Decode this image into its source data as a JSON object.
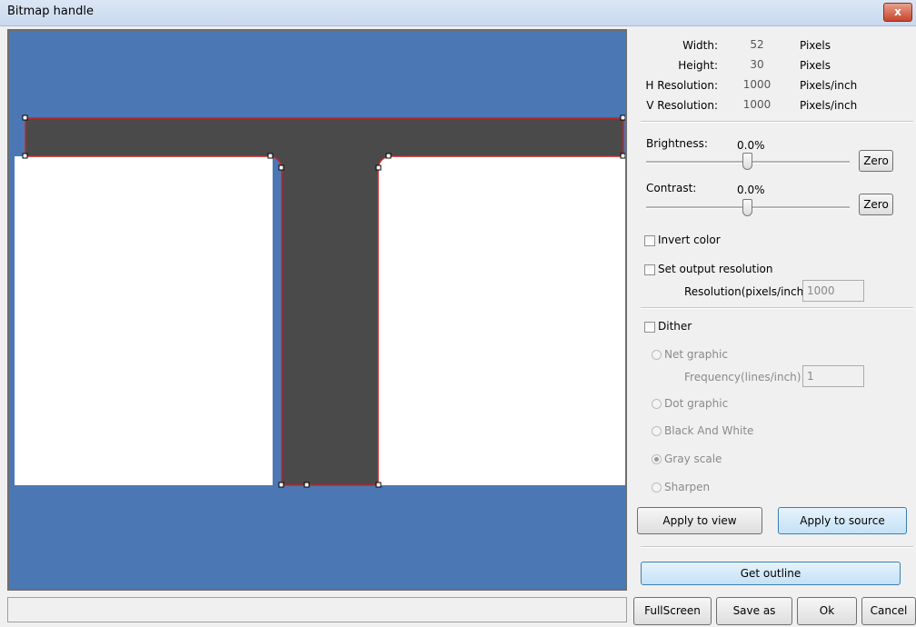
{
  "window": {
    "title": "Bitmap handle",
    "close_symbol": "x"
  },
  "properties": [
    {
      "label": "Width:",
      "value": "52",
      "unit": "Pixels"
    },
    {
      "label": "Height:",
      "value": "30",
      "unit": "Pixels"
    },
    {
      "label": "H Resolution:",
      "value": "1000",
      "unit": "Pixels/inch"
    },
    {
      "label": "V Resolution:",
      "value": "1000",
      "unit": "Pixels/inch"
    }
  ],
  "adjust": {
    "brightness": {
      "label": "Brightness:",
      "value": "0.0%",
      "zero_label": "Zero"
    },
    "contrast": {
      "label": "Contrast:",
      "value": "0.0%",
      "zero_label": "Zero"
    }
  },
  "options": {
    "invert_color": {
      "label": "Invert color",
      "checked": false
    },
    "set_output_resolution": {
      "label": "Set output resolution",
      "checked": false
    },
    "resolution_label": "Resolution(pixels/inch)",
    "resolution_value": "1000"
  },
  "dither": {
    "label": "Dither",
    "checked": false,
    "net_graphic": "Net graphic",
    "frequency_label": "Frequency(lines/inch):",
    "frequency_value": "1",
    "dot_graphic": "Dot graphic",
    "black_and_white": "Black And White",
    "gray_scale": "Gray scale",
    "sharpen": "Sharpen",
    "selected": "Gray scale"
  },
  "buttons": {
    "apply_to_view": "Apply to view",
    "apply_to_source": "Apply to source",
    "get_outline": "Get outline",
    "fullscreen": "FullScreen",
    "save_as": "Save as",
    "ok": "Ok",
    "cancel": "Cancel"
  },
  "colors": {
    "canvas_background": "#4b78b5",
    "shape_fill": "#4a4a4a",
    "outline": "#cc2222",
    "button_accent": "#3c7fb1"
  }
}
